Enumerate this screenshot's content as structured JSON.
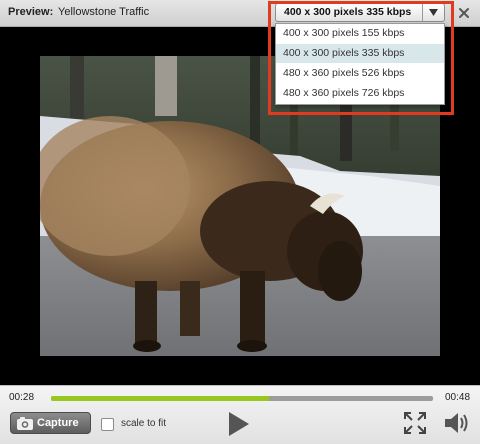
{
  "header": {
    "label": "Preview:",
    "title": "Yellowstone Traffic"
  },
  "quality": {
    "selected": "400 x 300 pixels 335 kbps",
    "options": [
      "400 x 300 pixels 155 kbps",
      "400 x 300 pixels 335 kbps",
      "480 x 360 pixels 526 kbps",
      "480 x 360 pixels 726 kbps"
    ],
    "highlighted_index": 1
  },
  "player": {
    "current_time": "00:28",
    "duration": "00:48",
    "progress": 0.57,
    "capture_label": "Capture",
    "scale_label": "scale to fit",
    "scale_checked": false
  },
  "icons": {
    "close": "close-icon",
    "camera": "camera-icon",
    "play": "play-icon",
    "fullscreen": "fullscreen-icon",
    "volume": "volume-icon",
    "dropdown": "chevron-down-icon"
  },
  "colors": {
    "progress_fill": "#98c71f",
    "highlight_border": "#e13a1f",
    "selected_option_bg": "#d8e7ea"
  }
}
